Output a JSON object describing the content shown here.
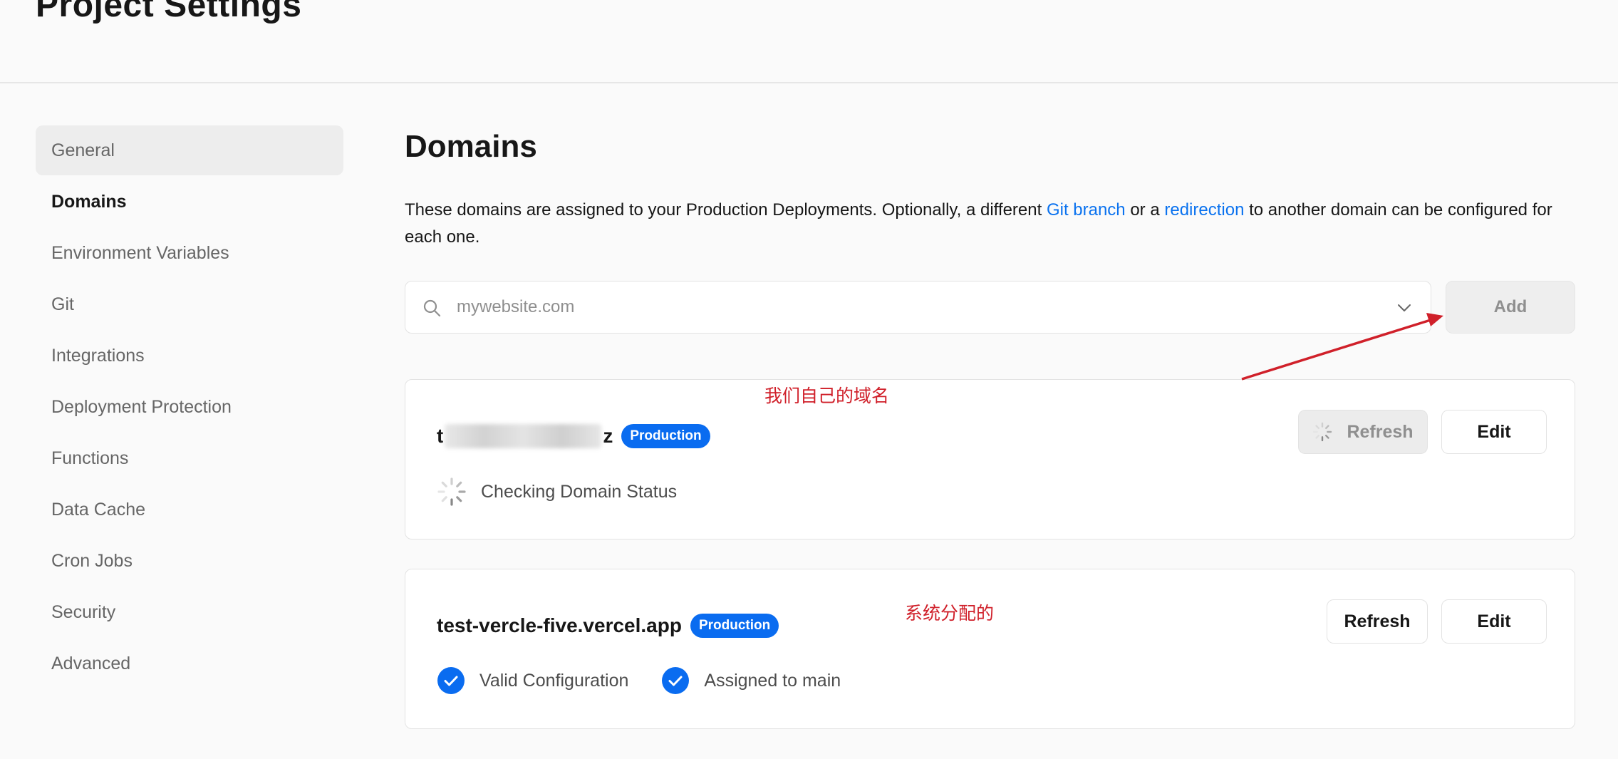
{
  "header": {
    "title": "Project Settings"
  },
  "sidebar": {
    "items": [
      {
        "label": "General"
      },
      {
        "label": "Domains"
      },
      {
        "label": "Environment Variables"
      },
      {
        "label": "Git"
      },
      {
        "label": "Integrations"
      },
      {
        "label": "Deployment Protection"
      },
      {
        "label": "Functions"
      },
      {
        "label": "Data Cache"
      },
      {
        "label": "Cron Jobs"
      },
      {
        "label": "Security"
      },
      {
        "label": "Advanced"
      }
    ]
  },
  "main": {
    "title": "Domains",
    "description": {
      "part1": "These domains are assigned to your Production Deployments. Optionally, a different ",
      "link1": "Git branch",
      "part2": " or a ",
      "link2": "redirection",
      "part3": " to another domain can be configured for each one."
    },
    "search": {
      "placeholder": "mywebsite.com",
      "value": ""
    },
    "add_label": "Add",
    "domains": [
      {
        "name_prefix": "t",
        "name_suffix": "z",
        "badge": "Production",
        "status": "Checking Domain Status",
        "refresh_label": "Refresh",
        "edit_label": "Edit"
      },
      {
        "name": "test-vercle-five.vercel.app",
        "badge": "Production",
        "status1": "Valid Configuration",
        "status2": "Assigned to main",
        "refresh_label": "Refresh",
        "edit_label": "Edit"
      }
    ]
  },
  "annotations": {
    "note1": "我们自己的域名",
    "note2": "系统分配的"
  },
  "colors": {
    "link": "#0a72ef",
    "badge": "#0a6cf0",
    "annotation": "#d0202a"
  },
  "icons": [
    "search-icon",
    "chevron-down-icon",
    "spinner-icon",
    "check-circle-icon",
    "arrow-annotation"
  ]
}
